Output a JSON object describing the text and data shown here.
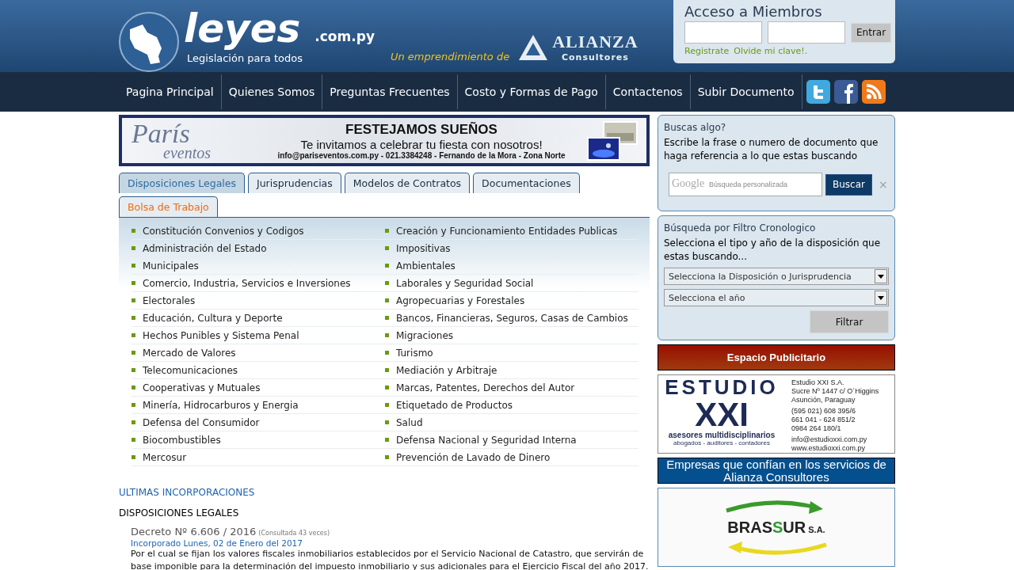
{
  "header": {
    "logo_name": "leyes",
    "logo_domain": ".com.py",
    "tagline": "Legislación para todos",
    "partner_prefix": "Un emprendimiento de",
    "partner_name": "ALIANZA",
    "partner_sub": "Consultores"
  },
  "login": {
    "title": "Acceso a Miembros",
    "button": "Entrar",
    "links": [
      "Registrate",
      "Olvide mi clave!."
    ]
  },
  "nav": {
    "items": [
      "Pagina Principal",
      "Quienes Somos",
      "Preguntas Frecuentes",
      "Costo y Formas de Pago",
      "Contactenos",
      "Subir Documento"
    ],
    "social": [
      {
        "kind": "twitter"
      },
      {
        "kind": "facebook"
      },
      {
        "kind": "rss"
      }
    ]
  },
  "top_banner": {
    "brand": "París",
    "brand_sub": "eventos",
    "headline": "FESTEJAMOS SUEÑOS",
    "line": "Te invitamos a celebrar tu fiesta con nosotros!",
    "contact": "info@pariseventos.com.py - 021.3384248 - Fernando de la Mora - Zona Norte"
  },
  "tabs": [
    {
      "label": "Disposiciones Legales",
      "selected": true,
      "kind": "normal"
    },
    {
      "label": "Jurisprudencias",
      "selected": false,
      "kind": "normal"
    },
    {
      "label": "Modelos de Contratos",
      "selected": false,
      "kind": "normal"
    },
    {
      "label": "Documentaciones",
      "selected": false,
      "kind": "normal"
    },
    {
      "label": "Bolsa de Trabajo",
      "selected": false,
      "kind": "highlight"
    }
  ],
  "categories": [
    [
      "Constitución Convenios y Codigos",
      "Creación y Funcionamiento Entidades Publicas"
    ],
    [
      "Administración del Estado",
      "Impositivas"
    ],
    [
      "Municipales",
      "Ambientales"
    ],
    [
      "Comercio, Industria, Servicios e Inversiones",
      "Laborales y Seguridad Social"
    ],
    [
      "Electorales",
      "Agropecuarias y Forestales"
    ],
    [
      "Educación, Cultura y Deporte",
      "Bancos, Financieras, Seguros, Casas de Cambios"
    ],
    [
      "Hechos Punibles y Sistema Penal",
      "Migraciones"
    ],
    [
      "Mercado de Valores",
      "Turismo"
    ],
    [
      "Telecomunicaciones",
      "Mediación y Arbitraje"
    ],
    [
      "Cooperativas y Mutuales",
      "Marcas, Patentes, Derechos del Autor"
    ],
    [
      "Minería, Hidrocarburos y Energia",
      "Etiquetado de Productos"
    ],
    [
      "Defensa del Consumidor",
      "Salud"
    ],
    [
      "Biocombustibles",
      "Defensa Nacional y Seguridad Interna"
    ],
    [
      "Mercosur",
      "Prevención de Lavado de Dinero"
    ]
  ],
  "latest": {
    "heading": "ULTIMAS INCORPORACIONES",
    "section": "DISPOSICIONES LEGALES",
    "items": [
      {
        "title": "Decreto Nº 6.606 / 2016",
        "views": "(Consultada 43 veces)",
        "date": "Incorporado Lunes, 02 de Enero del 2017",
        "summary": "Por el cual se fijan los valores fiscales inmobiliarios establecidos por el Servicio Nacional de Catastro, que servirán de base imponible para la determinación del impuesto inmobiliario y sus adicionales para el Ejercicio Fiscal del año 2017."
      }
    ]
  },
  "search_box": {
    "title": "Buscas algo?",
    "text": "Escribe la frase o numero de documento que haga referencia a lo que estas buscando",
    "brand": "Google",
    "placeholder": "Búsqueda personalizada",
    "button": "Buscar",
    "clear": "×"
  },
  "filter_box": {
    "title": "Búsqueda por Filtro Cronologico",
    "text": "Selecciona el tipo y año de la disposición que estas buscando...",
    "selects": [
      "Selecciona la Disposición o Jurisprudencia",
      "Selecciona el año"
    ],
    "button": "Filtrar"
  },
  "ad_heading": "Espacio Publicitario",
  "ad": {
    "brand": "ESTUDIO",
    "brand_big": "XXI",
    "slogan": "asesores multidisciplinarios",
    "slogan_sub": "abogados - auditores - contadores",
    "address": [
      "Estudio XXI S.A.",
      "Sucre Nº 1447 c/ O´Higgins",
      "Asunción, Paraguay"
    ],
    "phones": [
      "(595 021) 608 395/6",
      "661 041 -  624 851/2",
      "0984 264 180/1"
    ],
    "web": [
      "info@estudioxxi.com.py",
      "www.estudioxxi.com.py"
    ]
  },
  "clients_heading": "Empresas que confían en los servicios de Alianza Consultores",
  "client": {
    "name_a": "BRAS",
    "name_b": "S",
    "name_c": "UR",
    "suffix": "S.A."
  }
}
